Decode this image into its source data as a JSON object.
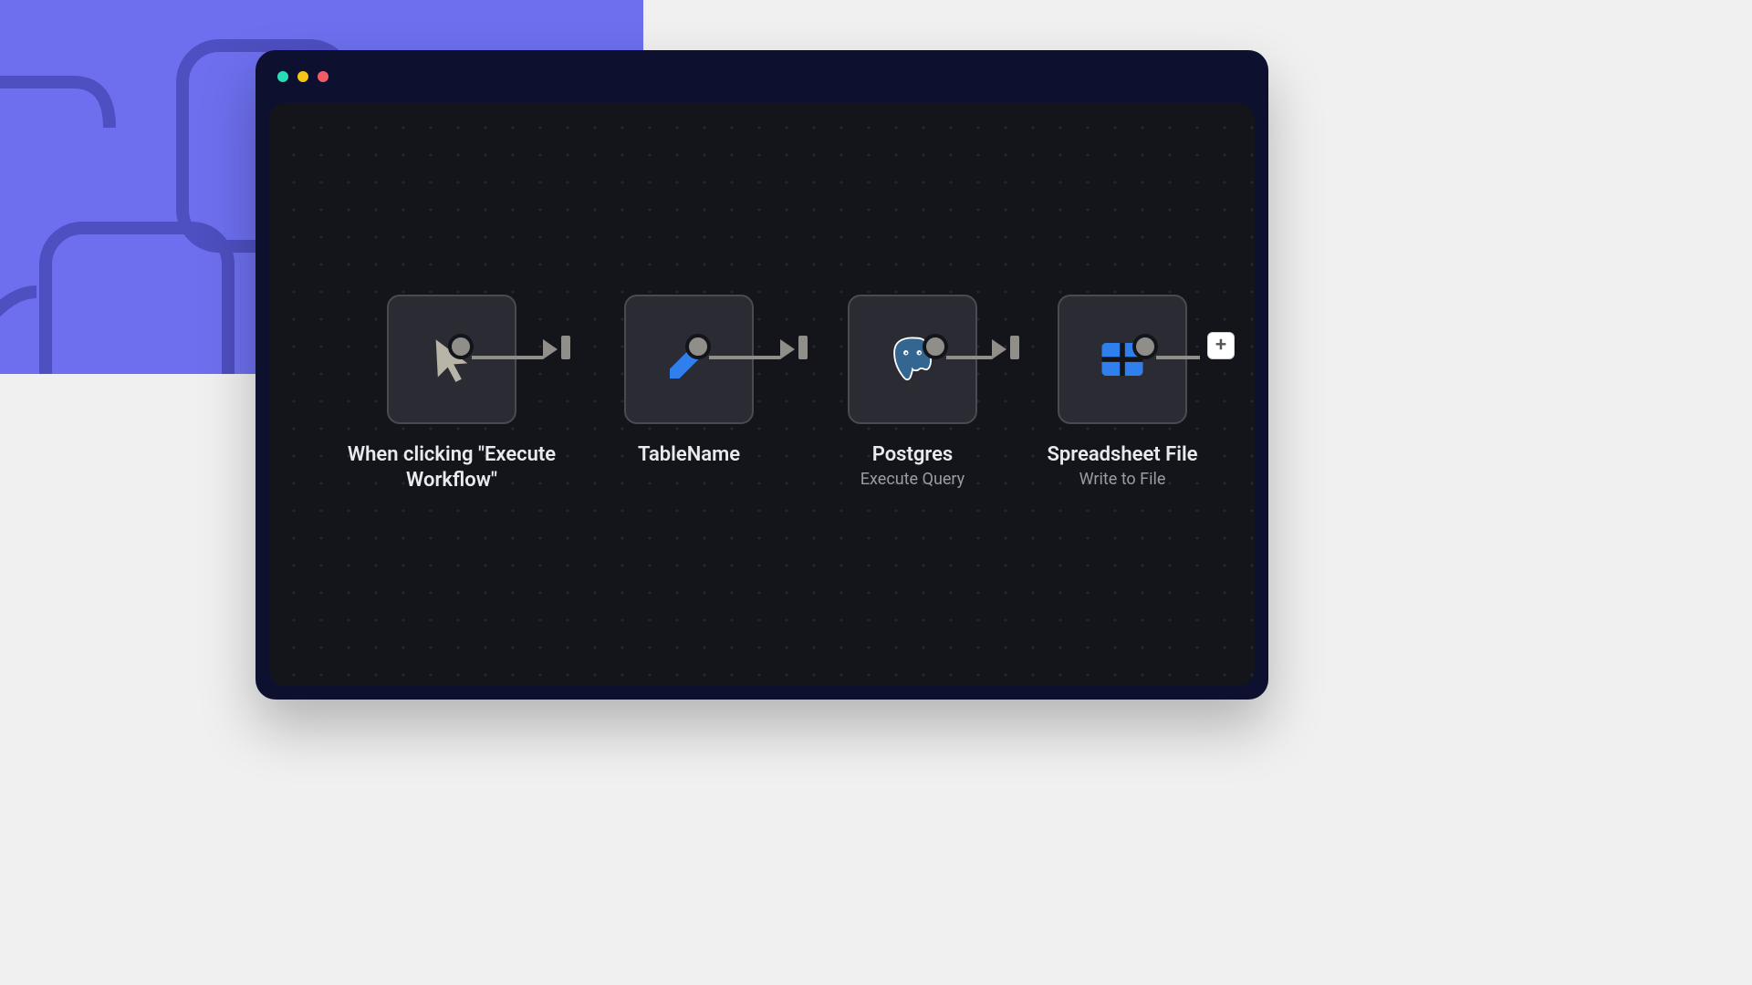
{
  "colors": {
    "bg_panel": "#6D6FEE",
    "window_bg": "#0E1030",
    "canvas_bg": "#14151B",
    "node_bg": "#2B2C33",
    "node_border": "#4A4B52",
    "connector": "#8F8E88",
    "text_primary": "#E9EAEE",
    "text_secondary": "#9A9CA5",
    "icon_blue": "#2F80ED",
    "icon_gray": "#B8B4A8"
  },
  "window": {
    "traffic_lights": [
      "close",
      "minimize",
      "maximize"
    ]
  },
  "workflow": {
    "nodes": [
      {
        "id": "trigger",
        "icon": "cursor-icon",
        "title": "When clicking \"Execute Workflow\"",
        "subtitle": ""
      },
      {
        "id": "tablename",
        "icon": "pencil-icon",
        "title": "TableName",
        "subtitle": ""
      },
      {
        "id": "postgres",
        "icon": "postgres-icon",
        "title": "Postgres",
        "subtitle": "Execute Query"
      },
      {
        "id": "spreadsheet",
        "icon": "spreadsheet-icon",
        "title": "Spreadsheet File",
        "subtitle": "Write to File"
      }
    ],
    "add_button_label": "+"
  }
}
